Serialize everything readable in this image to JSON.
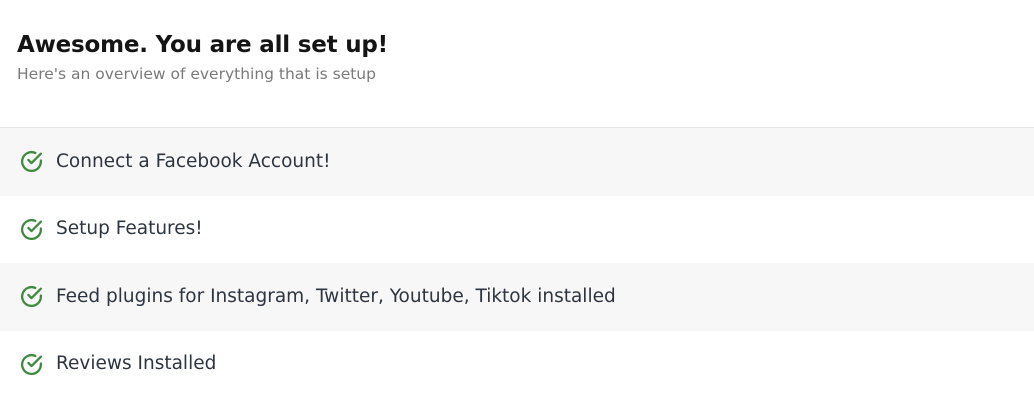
{
  "header": {
    "title": "Awesome. You are all set up!",
    "subtitle": "Here's an overview of everything that is setup"
  },
  "checklist": {
    "icon": "check-circle-icon",
    "icon_color": "#3f8a3f",
    "items": [
      {
        "label": "Connect a Facebook Account!",
        "status": "completed"
      },
      {
        "label": "Setup Features!",
        "status": "completed"
      },
      {
        "label": "Feed plugins for Instagram, Twitter, Youtube, Tiktok installed",
        "status": "completed"
      },
      {
        "label": "Reviews Installed",
        "status": "completed"
      }
    ]
  },
  "colors": {
    "row_shaded": "#f7f7f7",
    "divider": "#e6e6e6",
    "text": "#2d3540"
  }
}
